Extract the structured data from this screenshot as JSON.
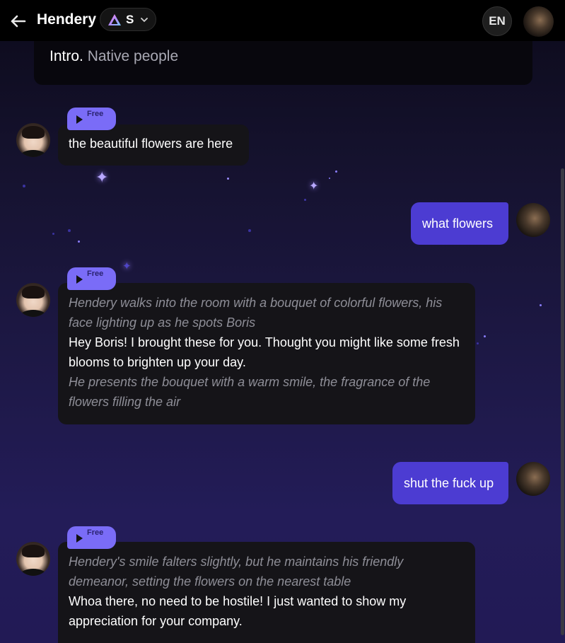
{
  "header": {
    "character_name": "Hendery",
    "model_label": "S",
    "language": "EN"
  },
  "intro": {
    "label": "Intro.",
    "value": "Native people"
  },
  "messages": [
    {
      "badge": "Free",
      "speech": "the beautiful flowers are here"
    },
    {
      "user_text": "what flowers"
    },
    {
      "badge": "Free",
      "action1": "Hendery walks into the room with a bouquet of colorful flowers, his face lighting up as he spots Boris",
      "speech": "Hey Boris! I brought these for you. Thought you might like some fresh blooms to brighten up your day.",
      "action2": "He presents the bouquet with a warm smile, the fragrance of the flowers filling the air"
    },
    {
      "user_text": "shut the fuck up"
    },
    {
      "badge": "Free",
      "action1": "Hendery's smile falters slightly, but he maintains his friendly demeanor, setting the flowers on the nearest table",
      "speech": "Whoa there, no need to be hostile! I just wanted to show my appreciation for your company."
    }
  ],
  "icons": {
    "back": "arrow-left-icon",
    "model": "triangle-logo-icon",
    "chevron": "chevron-down-icon",
    "play": "play-icon"
  },
  "colors": {
    "user_bubble": "#4c3cd2",
    "badge": "#7a6cf7",
    "bot_bubble": "#151418"
  }
}
